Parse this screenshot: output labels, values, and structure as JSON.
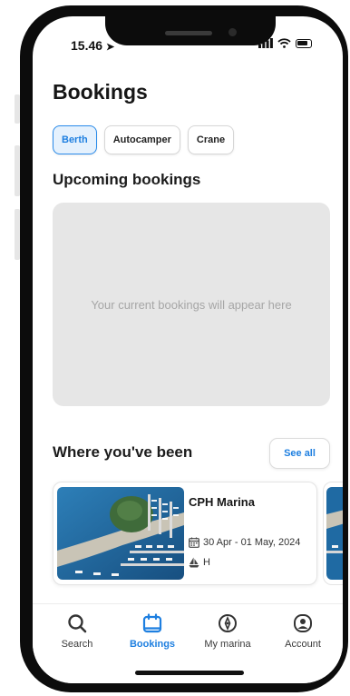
{
  "status_bar": {
    "time": "15.46",
    "location_arrow": "➤"
  },
  "page": {
    "title": "Bookings"
  },
  "tabs": [
    {
      "label": "Berth",
      "active": true
    },
    {
      "label": "Autocamper",
      "active": false
    },
    {
      "label": "Crane",
      "active": false
    }
  ],
  "upcoming": {
    "heading": "Upcoming bookings",
    "empty_text": "Your current bookings will appear here"
  },
  "history": {
    "heading": "Where you've been",
    "see_all_label": "See all",
    "cards": [
      {
        "name": "CPH Marina",
        "dates": "30 Apr - 01 May, 2024",
        "berth": "H"
      }
    ]
  },
  "bottom_nav": [
    {
      "label": "Search",
      "icon": "search-icon",
      "active": false
    },
    {
      "label": "Bookings",
      "icon": "calendar-icon",
      "active": true
    },
    {
      "label": "My marina",
      "icon": "marina-icon",
      "active": false
    },
    {
      "label": "Account",
      "icon": "account-icon",
      "active": false
    }
  ],
  "colors": {
    "accent": "#1e7fe0",
    "accent_bg": "#e5f1fd",
    "empty_box": "#e6e6e6"
  }
}
